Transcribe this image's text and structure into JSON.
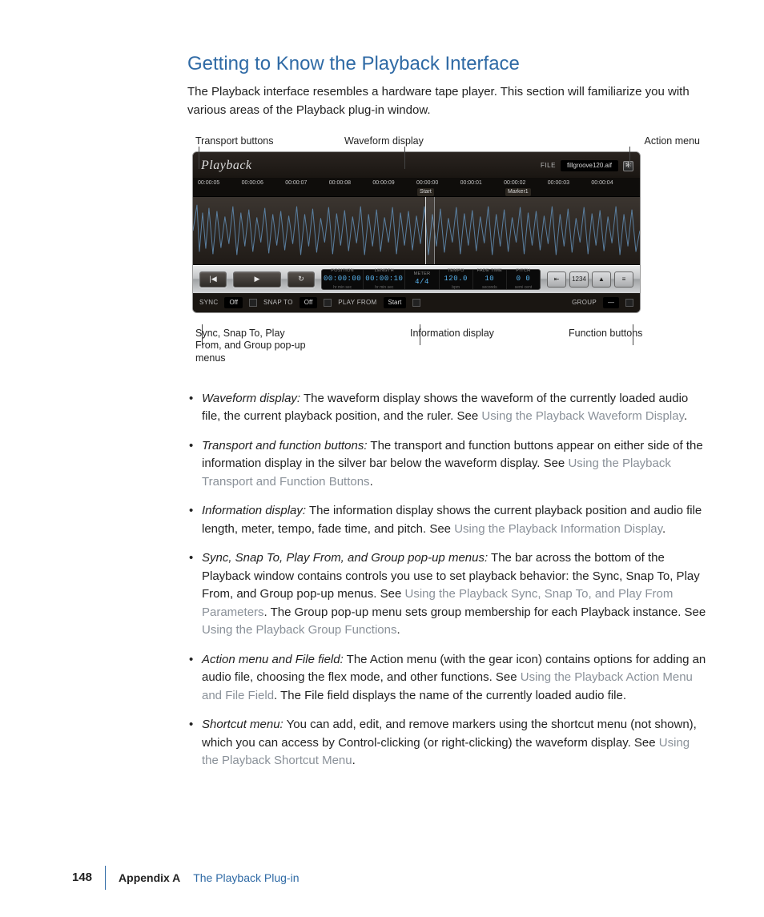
{
  "heading": "Getting to Know the Playback Interface",
  "intro": "The Playback interface resembles a hardware tape player. This section will familiarize you with various areas of the Playback plug-in window.",
  "callouts_top": {
    "transport": "Transport buttons",
    "waveform": "Waveform display",
    "action": "Action menu"
  },
  "callouts_bottom": {
    "popups": "Sync, Snap To, Play From, and Group pop-up menus",
    "info": "Information display",
    "funcs": "Function buttons"
  },
  "plugin": {
    "logo": "Playback",
    "file_label": "FILE",
    "file_name": "fillgroove120.aif",
    "ruler": [
      "00:00:05",
      "00:00:06",
      "00:00:07",
      "00:00:08",
      "00:00:09",
      "00:00:00",
      "00:00:01",
      "00:00:02",
      "00:00:03",
      "00:00:04"
    ],
    "markers": {
      "start": "Start",
      "m1": "Marker1"
    },
    "transport": {
      "prev": "|◀",
      "play": "▶",
      "cycle": "↻"
    },
    "info": {
      "position": {
        "label": "POSITION",
        "value": "00:00:00",
        "sub": "hr  min  sec"
      },
      "length": {
        "label": "LENGTH",
        "value": "00:00:10",
        "sub": "hr  min  sec"
      },
      "meter": {
        "label": "METER",
        "value": "4/4",
        "sub": ""
      },
      "tempo": {
        "label": "TEMPO",
        "value": "120.0",
        "sub": "bpm"
      },
      "fade": {
        "label": "FADE TIME",
        "value": "10",
        "sub": "seconds"
      },
      "pitch": {
        "label": "PITCH",
        "value": "0  0",
        "sub": "semi   cent"
      }
    },
    "func_buttons": [
      "⇤",
      "1234",
      "▲",
      "≡"
    ],
    "bottom": {
      "sync_label": "SYNC",
      "sync_val": "Off",
      "snap_label": "SNAP TO",
      "snap_val": "Off",
      "play_label": "PLAY FROM",
      "play_val": "Start",
      "group_label": "GROUP",
      "group_val": "—"
    }
  },
  "bullets": [
    {
      "term": "Waveform display:",
      "text1": "  The waveform display shows the waveform of the currently loaded audio file, the current playback position, and the ruler. See ",
      "link1": "Using the Playback Waveform Display",
      "tail1": "."
    },
    {
      "term": "Transport and function buttons:",
      "text1": "  The transport and function buttons appear on either side of the information display in the silver bar below the waveform display. See ",
      "link1": "Using the Playback Transport and Function Buttons",
      "tail1": "."
    },
    {
      "term": "Information display:",
      "text1": "  The information display shows the current playback position and audio file length, meter, tempo, fade time, and pitch. See ",
      "link1": "Using the Playback Information Display",
      "tail1": "."
    },
    {
      "term": "Sync, Snap To, Play From, and Group pop-up menus:",
      "text1": "  The bar across the bottom of the Playback window contains controls you use to set playback behavior: the Sync, Snap To, Play From, and Group pop-up menus. See ",
      "link1": "Using the Playback Sync, Snap To, and Play From Parameters",
      "tail1": ". The Group pop-up menu sets group membership for each Playback instance. See ",
      "link2": "Using the Playback Group Functions",
      "tail2": "."
    },
    {
      "term": "Action menu and File field:",
      "text1": "  The Action menu (with the gear icon) contains options for adding an audio file, choosing the flex mode, and other functions. See ",
      "link1": "Using the Playback Action Menu and File Field",
      "tail1": ". The File field displays the name of the currently loaded audio file."
    },
    {
      "term": "Shortcut menu:",
      "text1": "  You can add, edit, and remove markers using the shortcut menu (not shown), which you can access by Control-clicking (or right-clicking) the waveform display. See ",
      "link1": "Using the Playback Shortcut Menu",
      "tail1": "."
    }
  ],
  "footer": {
    "page": "148",
    "appendix": "Appendix A",
    "title": "The Playback Plug-in"
  }
}
